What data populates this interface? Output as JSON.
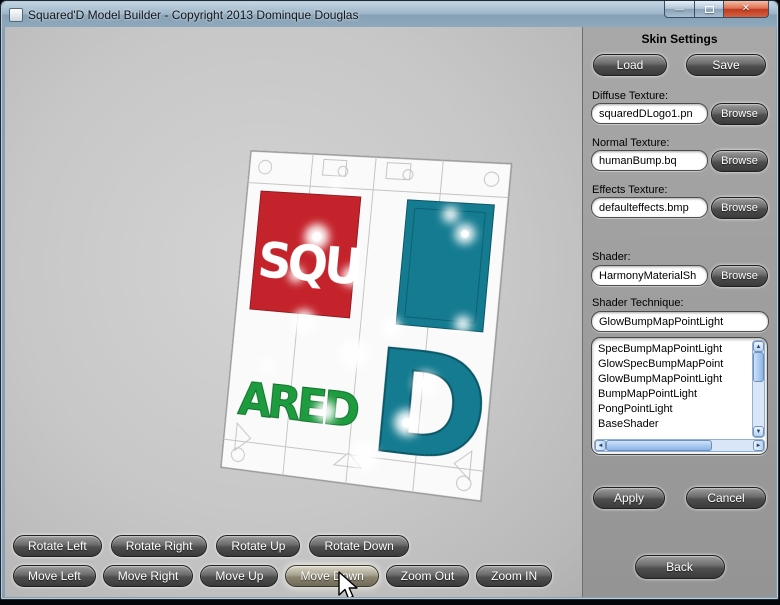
{
  "window": {
    "title": "Squared'D Model Builder - Copyright 2013 Dominque Douglas",
    "minimize_glyph": "—",
    "close_glyph": "✕"
  },
  "skin_panel": {
    "title": "Skin Settings",
    "load_button": "Load",
    "save_button": "Save",
    "browse_button": "Browse",
    "diffuse_label": "Diffuse Texture:",
    "diffuse_value": "squaredDLogo1.pn",
    "normal_label": "Normal Texture:",
    "normal_value": "humanBump.bq",
    "effects_label": "Effects Texture:",
    "effects_value": "defaulteffects.bmp",
    "shader_label": "Shader:",
    "shader_value": "HarmonyMaterialSh",
    "technique_label": "Shader Technique:",
    "technique_value": "GlowBumpMapPointLight",
    "technique_list": [
      "SpecBumpMapPointLight",
      "GlowSpecBumpMapPoint",
      "GlowBumpMapPointLight",
      "BumpMapPointLight",
      "PongPointLight",
      "BaseShader"
    ],
    "apply_button": "Apply",
    "cancel_button": "Cancel",
    "back_button": "Back"
  },
  "viewport": {
    "rotate_buttons": [
      "Rotate Left",
      "Rotate Right",
      "Rotate Up",
      "Rotate Down"
    ],
    "move_buttons": [
      "Move Left",
      "Move Right",
      "Move Up",
      "Move Down",
      "Zoom Out",
      "Zoom IN"
    ],
    "logo": {
      "squ": "SQU",
      "ared": "ARED",
      "big_d": "D"
    }
  },
  "scrollbar": {
    "up": "▲",
    "down": "▼",
    "left": "◄",
    "right": "►"
  },
  "colors": {
    "logo_red": "#c4232b",
    "logo_green": "#1d9b3f",
    "logo_teal": "#147b90",
    "scrollbar_blue": "#8ab4e8",
    "panel_gray": "#a0a0a0",
    "titlebar_blue": "#8fa9bd",
    "button_dark": "#4e4e4e"
  }
}
